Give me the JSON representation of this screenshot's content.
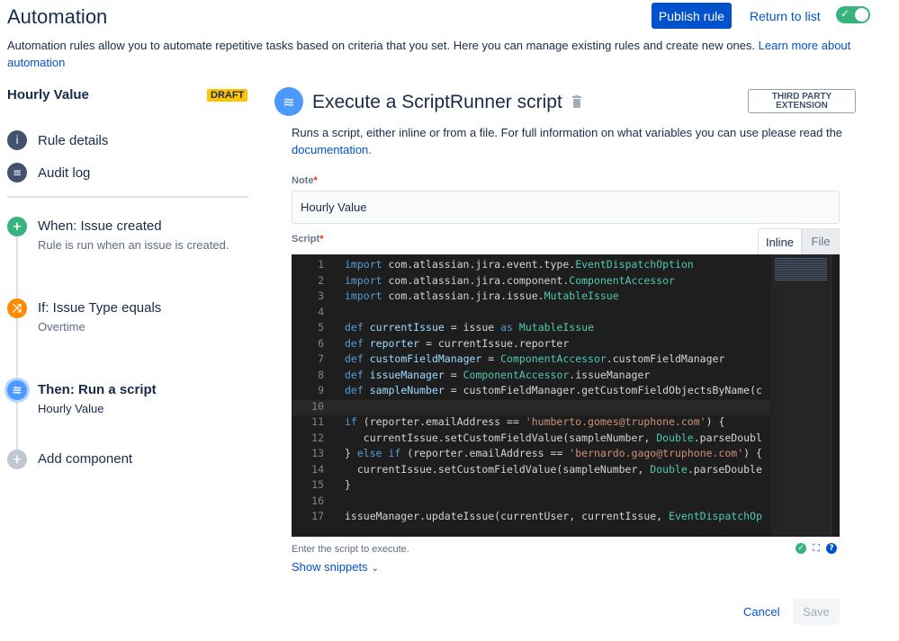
{
  "header": {
    "title": "Automation",
    "publish_label": "Publish rule",
    "return_label": "Return to list",
    "toggle_on": true
  },
  "description": {
    "text": "Automation rules allow you to automate repetitive tasks based on criteria that you set. Here you can manage existing rules and create new ones. ",
    "link": "Learn more about automation"
  },
  "sidebar": {
    "rule_name": "Hourly Value",
    "status_badge": "DRAFT",
    "nav": [
      {
        "label": "Rule details",
        "icon": "info-icon"
      },
      {
        "label": "Audit log",
        "icon": "list-icon"
      }
    ],
    "steps": [
      {
        "title": "When: Issue created",
        "subtitle": "Rule is run when an issue is created.",
        "icon": "plus-icon",
        "color": "#36b37e"
      },
      {
        "title": "If: Issue Type equals",
        "subtitle": "Overtime",
        "icon": "shuffle-icon",
        "color": "#ff8b00"
      },
      {
        "title": "Then: Run a script",
        "subtitle": "Hourly Value",
        "icon": "scriptrunner-icon",
        "color": "#4c9aff"
      },
      {
        "title": "Add component",
        "subtitle": "",
        "icon": "plus-icon",
        "color": "#c1c7d0"
      }
    ]
  },
  "action": {
    "title": "Execute a ScriptRunner script",
    "badge": "THIRD PARTY EXTENSION",
    "description": "Runs a script, either inline or from a file. For full information on what variables you can use please read the ",
    "description_link": "documentation.",
    "note_label": "Note",
    "note_value": "Hourly Value",
    "script_label": "Script",
    "tabs": [
      "Inline",
      "File"
    ],
    "helper_text": "Enter the script to execute.",
    "show_snippets": "Show snippets",
    "cancel_label": "Cancel",
    "save_label": "Save"
  },
  "code": [
    {
      "n": "1",
      "text": "import com.atlassian.jira.event.type.EventDispatchOption"
    },
    {
      "n": "2",
      "text": "import com.atlassian.jira.component.ComponentAccessor"
    },
    {
      "n": "3",
      "text": "import com.atlassian.jira.issue.MutableIssue"
    },
    {
      "n": "4",
      "text": ""
    },
    {
      "n": "5",
      "text": "def currentIssue = issue as MutableIssue"
    },
    {
      "n": "6",
      "text": "def reporter = currentIssue.reporter"
    },
    {
      "n": "7",
      "text": "def customFieldManager = ComponentAccessor.customFieldManager"
    },
    {
      "n": "8",
      "text": "def issueManager = ComponentAccessor.issueManager"
    },
    {
      "n": "9",
      "text": "def sampleNumber = customFieldManager.getCustomFieldObjectsByName(c"
    },
    {
      "n": "10",
      "text": ""
    },
    {
      "n": "11",
      "text": "if (reporter.emailAddress == 'humberto.gomes@truphone.com') {"
    },
    {
      "n": "12",
      "text": "   currentIssue.setCustomFieldValue(sampleNumber, Double.parseDoubl"
    },
    {
      "n": "13",
      "text": "} else if (reporter.emailAddress == 'bernardo.gago@truphone.com') {"
    },
    {
      "n": "14",
      "text": "  currentIssue.setCustomFieldValue(sampleNumber, Double.parseDouble"
    },
    {
      "n": "15",
      "text": "}"
    },
    {
      "n": "16",
      "text": ""
    },
    {
      "n": "17",
      "text": "issueManager.updateIssue(currentUser, currentIssue, EventDispatchOp"
    }
  ]
}
